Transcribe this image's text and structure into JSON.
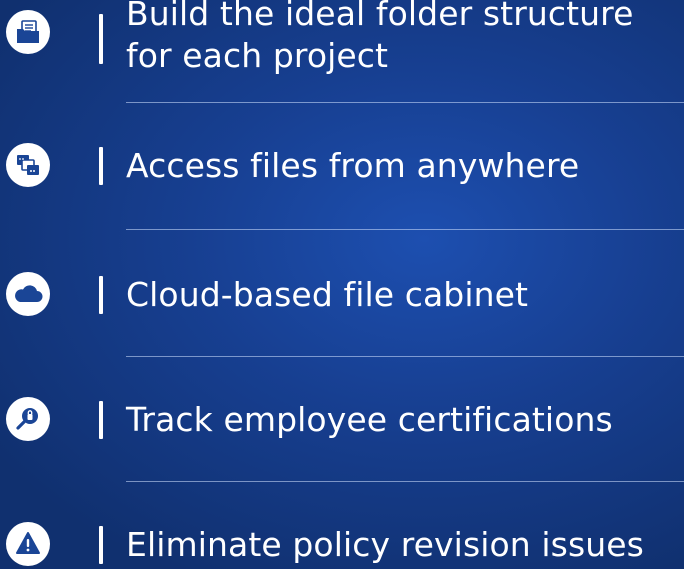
{
  "features": [
    {
      "icon": "folder-documents-icon",
      "lines": [
        "Build the ideal folder structure",
        "for each project"
      ]
    },
    {
      "icon": "multi-window-icon",
      "lines": [
        "Access files from anywhere"
      ]
    },
    {
      "icon": "cloud-icon",
      "lines": [
        "Cloud-based file cabinet"
      ]
    },
    {
      "icon": "certificate-search-icon",
      "lines": [
        "Track employee certifications"
      ]
    },
    {
      "icon": "warning-icon",
      "lines": [
        "Eliminate policy revision issues"
      ]
    }
  ],
  "colors": {
    "background": "#173f91",
    "foreground": "#ffffff",
    "icon_fill": "#1a4596"
  }
}
